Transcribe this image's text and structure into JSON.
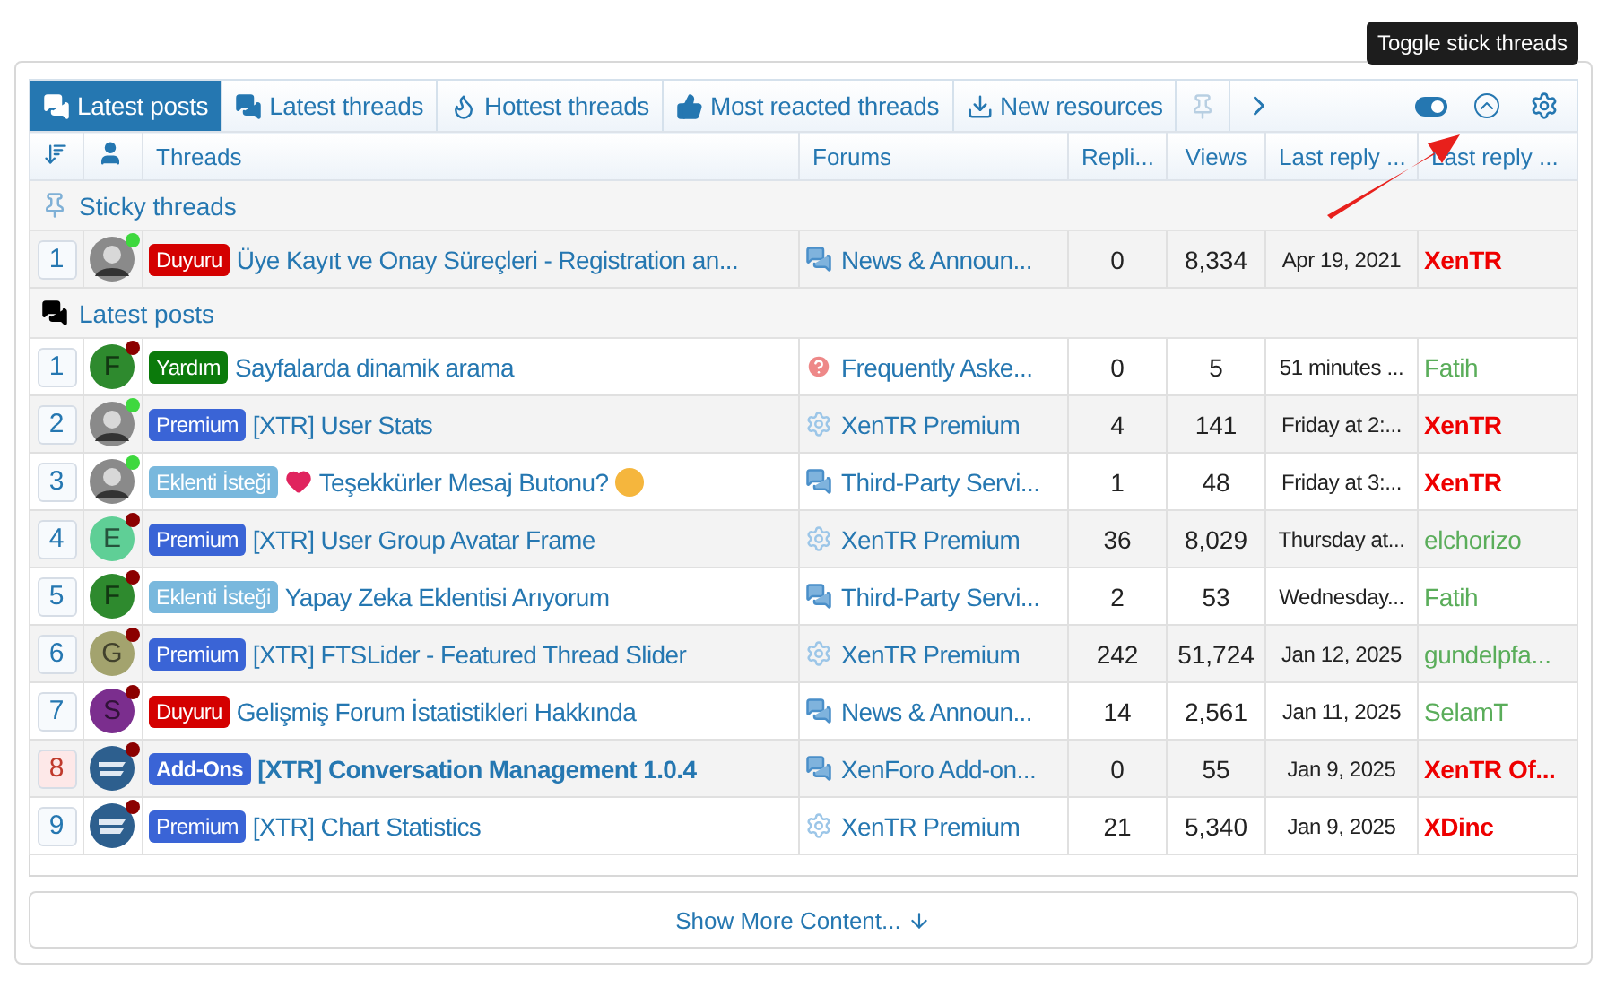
{
  "tooltip": "Toggle stick threads",
  "tabs": [
    {
      "label": "Latest posts",
      "selected": true,
      "kind": "chat"
    },
    {
      "label": "Latest threads",
      "selected": false,
      "kind": "chat"
    },
    {
      "label": "Hottest threads",
      "selected": false,
      "kind": "fire"
    },
    {
      "label": "Most reacted threads",
      "selected": false,
      "kind": "thumb"
    },
    {
      "label": "New resources",
      "selected": false,
      "kind": "download"
    }
  ],
  "toggle_on": true,
  "columns": [
    "Threads",
    "Forums",
    "Repli...",
    "Views",
    "Last reply ...",
    "Last reply ..."
  ],
  "sections": [
    {
      "title": "Sticky threads",
      "kind": "pin",
      "rows": [
        {
          "number": "1",
          "highlighted": false,
          "avatar": {
            "kind": "photo"
          },
          "online": true,
          "prefix": {
            "label": "Duyuru",
            "color": "#d40000"
          },
          "title": {
            "text": "Üye Kayıt ve Onay Süreçleri - Registration an...",
            "kind": "plain"
          },
          "bold": false,
          "forum": {
            "name": "News & Announ...",
            "kind": "chat"
          },
          "replies": "0",
          "views": "8,334",
          "date": "Apr 19, 2021",
          "user": {
            "name": "XenTR",
            "kind": "staff"
          }
        }
      ]
    },
    {
      "title": "Latest posts",
      "kind": "chat",
      "rows": [
        {
          "number": "1",
          "highlighted": false,
          "avatar": {
            "kind": "letter",
            "letter": "F",
            "color": "#2e8a2e"
          },
          "online": false,
          "prefix": {
            "label": "Yardım",
            "color": "#0b7a0b"
          },
          "title": {
            "text": "Sayfalarda dinamik arama",
            "kind": "plain"
          },
          "bold": false,
          "forum": {
            "name": "Frequently Aske...",
            "kind": "question"
          },
          "replies": "0",
          "views": "5",
          "date": "51 minutes ...",
          "user": {
            "name": "Fatih",
            "kind": "member"
          }
        },
        {
          "number": "2",
          "highlighted": false,
          "avatar": {
            "kind": "photo"
          },
          "online": true,
          "prefix": {
            "label": "Premium",
            "color": "#3a64d6"
          },
          "title": {
            "text": "[XTR] User Stats",
            "kind": "plain"
          },
          "bold": false,
          "forum": {
            "name": "XenTR Premium",
            "kind": "gear"
          },
          "replies": "4",
          "views": "141",
          "date": "Friday at 2:...",
          "user": {
            "name": "XenTR",
            "kind": "staff"
          }
        },
        {
          "number": "3",
          "highlighted": false,
          "avatar": {
            "kind": "photo"
          },
          "online": true,
          "prefix": {
            "label": "Eklenti İsteği",
            "color": "#79b8dd"
          },
          "title": {
            "text": "Teşekkürler Mesaj Butonu?",
            "kind": "decorated"
          },
          "bold": false,
          "forum": {
            "name": "Third-Party Servi...",
            "kind": "chat"
          },
          "replies": "1",
          "views": "48",
          "date": "Friday at 3:...",
          "user": {
            "name": "XenTR",
            "kind": "staff"
          }
        },
        {
          "number": "4",
          "highlighted": false,
          "avatar": {
            "kind": "letter",
            "letter": "E",
            "color": "#5fcf96"
          },
          "online": false,
          "prefix": {
            "label": "Premium",
            "color": "#3a64d6"
          },
          "title": {
            "text": "[XTR] User Group Avatar Frame",
            "kind": "plain"
          },
          "bold": false,
          "forum": {
            "name": "XenTR Premium",
            "kind": "gear"
          },
          "replies": "36",
          "views": "8,029",
          "date": "Thursday at...",
          "user": {
            "name": "elchorizo",
            "kind": "member"
          }
        },
        {
          "number": "5",
          "highlighted": false,
          "avatar": {
            "kind": "letter",
            "letter": "F",
            "color": "#2e8a2e"
          },
          "online": false,
          "prefix": {
            "label": "Eklenti İsteği",
            "color": "#79b8dd"
          },
          "title": {
            "text": "Yapay Zeka Eklentisi Arıyorum",
            "kind": "plain"
          },
          "bold": false,
          "forum": {
            "name": "Third-Party Servi...",
            "kind": "chat"
          },
          "replies": "2",
          "views": "53",
          "date": "Wednesday...",
          "user": {
            "name": "Fatih",
            "kind": "member"
          }
        },
        {
          "number": "6",
          "highlighted": false,
          "avatar": {
            "kind": "letter",
            "letter": "G",
            "color": "#a3a36e"
          },
          "online": false,
          "prefix": {
            "label": "Premium",
            "color": "#3a64d6"
          },
          "title": {
            "text": "[XTR] FTSLider - Featured Thread Slider",
            "kind": "plain"
          },
          "bold": false,
          "forum": {
            "name": "XenTR Premium",
            "kind": "gear"
          },
          "replies": "242",
          "views": "51,724",
          "date": "Jan 12, 2025",
          "user": {
            "name": "gundelpfa...",
            "kind": "member"
          }
        },
        {
          "number": "7",
          "highlighted": false,
          "avatar": {
            "kind": "letter",
            "letter": "S",
            "color": "#7b2e8e"
          },
          "online": false,
          "prefix": {
            "label": "Duyuru",
            "color": "#d40000"
          },
          "title": {
            "text": "Gelişmiş Forum İstatistikleri Hakkında",
            "kind": "plain"
          },
          "bold": false,
          "forum": {
            "name": "News & Announ...",
            "kind": "chat"
          },
          "replies": "14",
          "views": "2,561",
          "date": "Jan 11, 2025",
          "user": {
            "name": "SelamT",
            "kind": "member"
          }
        },
        {
          "number": "8",
          "highlighted": true,
          "avatar": {
            "kind": "logo"
          },
          "online": false,
          "prefix": {
            "label": "Add-Ons",
            "color": "#3a64d6"
          },
          "title": {
            "text": "[XTR] Conversation Management 1.0.4",
            "kind": "plain"
          },
          "bold": true,
          "forum": {
            "name": "XenForo Add-on...",
            "kind": "chat"
          },
          "replies": "0",
          "views": "55",
          "date": "Jan 9, 2025",
          "user": {
            "name": "XenTR Of...",
            "kind": "staff"
          }
        },
        {
          "number": "9",
          "highlighted": false,
          "avatar": {
            "kind": "logo"
          },
          "online": false,
          "prefix": {
            "label": "Premium",
            "color": "#3a64d6"
          },
          "title": {
            "text": "[XTR] Chart Statistics",
            "kind": "plain"
          },
          "bold": false,
          "forum": {
            "name": "XenTR Premium",
            "kind": "gear"
          },
          "replies": "21",
          "views": "5,340",
          "date": "Jan 9, 2025",
          "user": {
            "name": "XDinc",
            "kind": "staff"
          }
        }
      ]
    }
  ],
  "show_more": "Show More Content..."
}
